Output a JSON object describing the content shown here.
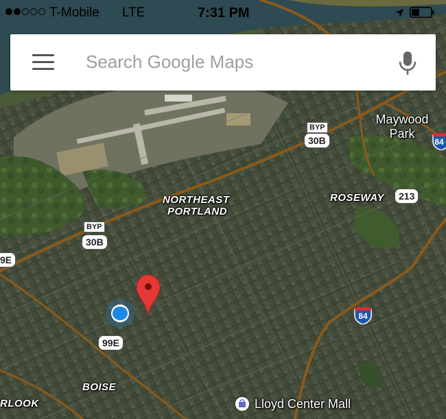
{
  "status_bar": {
    "signal_filled": 2,
    "signal_total": 5,
    "carrier": "T-Mobile",
    "network": "LTE",
    "time": "7:31 PM"
  },
  "search": {
    "placeholder": "Search Google Maps",
    "menu_icon": "hamburger-menu-icon",
    "mic_icon": "microphone-icon"
  },
  "map": {
    "neighborhoods": {
      "northeast_portland_line1": "NORTHEAST",
      "northeast_portland_line2": "PORTLAND",
      "roseway": "ROSEWAY",
      "boise": "BOISE",
      "rlook": "RLOOK"
    },
    "places": {
      "maywood_park_line1": "Maywood",
      "maywood_park_line2": "Park"
    },
    "routes": {
      "byp_top": "BYP",
      "us30b_top": "30B",
      "byp_left": "BYP",
      "us30b_left": "30B",
      "or213": "213",
      "or99e_lower": "99E",
      "or99e_edge": "9E",
      "i84_center": "84",
      "i84_edge": "84"
    },
    "poi": {
      "name": "Lloyd Center Mall",
      "icon": "shopping-bag-icon"
    },
    "colors": {
      "pin": "#e53935",
      "my_location": "#1e88e5",
      "interstate_blue": "#1f56a8",
      "interstate_red": "#d32f2f",
      "highway_brown": "#8a5a1c"
    }
  }
}
